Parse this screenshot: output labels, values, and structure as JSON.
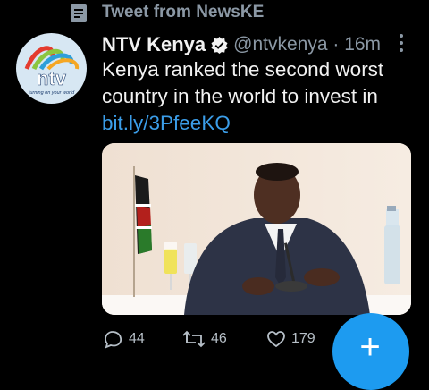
{
  "context": {
    "icon": "document-icon",
    "label": "Tweet from NewsKE"
  },
  "tweet": {
    "author_name": "NTV Kenya",
    "verified": true,
    "handle_time": "@ntvkenya · 16m",
    "text_line1": "Kenya ranked the second worst",
    "text_line2": "country in the world to invest in",
    "link": "bit.ly/3PfeeKQ",
    "avatar": {
      "logo_text": "ntv",
      "tagline": "turning on your world"
    },
    "media_icon": "press-conference-photo"
  },
  "actions": {
    "replies": "44",
    "retweets": "46",
    "likes": "179"
  },
  "fab": {
    "label": "+",
    "color": "#1d9bf0"
  },
  "colors": {
    "background": "#000000",
    "link": "#3b9de8",
    "verified": "#ffffff"
  }
}
